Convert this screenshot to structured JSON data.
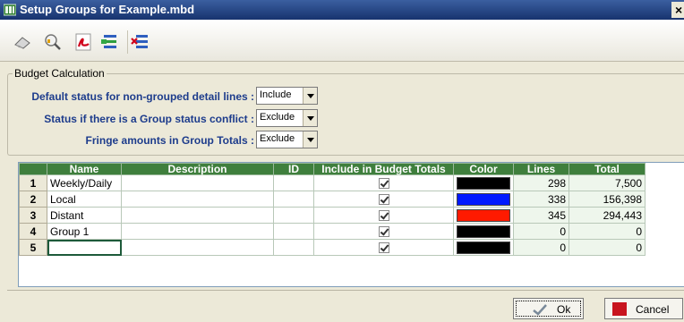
{
  "window": {
    "title": "Setup Groups for Example.mbd",
    "close_glyph": "×"
  },
  "toolbar": {
    "icons": [
      "eraser-icon",
      "search-icon",
      "pdf-icon",
      "add-group-icon",
      "delete-group-icon"
    ]
  },
  "budget_calc": {
    "legend": "Budget Calculation",
    "options": [
      {
        "label": "Default status for non-grouped detail lines :",
        "value": "Include"
      },
      {
        "label": "Status if there is a Group status conflict :",
        "value": "Exclude"
      },
      {
        "label": "Fringe amounts in Group Totals :",
        "value": "Exclude"
      }
    ]
  },
  "grid": {
    "columns": [
      "Name",
      "Description",
      "ID",
      "Include in Budget Totals",
      "Color",
      "Lines",
      "Total"
    ],
    "rows": [
      {
        "num": "1",
        "name": "Weekly/Daily",
        "description": "",
        "id": "",
        "include": true,
        "color": "#000000",
        "lines": "298",
        "total": "7,500"
      },
      {
        "num": "2",
        "name": "Local",
        "description": "",
        "id": "",
        "include": true,
        "color": "#0019ff",
        "lines": "338",
        "total": "156,398"
      },
      {
        "num": "3",
        "name": "Distant",
        "description": "",
        "id": "",
        "include": true,
        "color": "#ff1a00",
        "lines": "345",
        "total": "294,443"
      },
      {
        "num": "4",
        "name": "Group 1",
        "description": "",
        "id": "",
        "include": true,
        "color": "#000000",
        "lines": "0",
        "total": "0"
      },
      {
        "num": "5",
        "name": "",
        "description": "",
        "id": "",
        "include": true,
        "color": "#000000",
        "lines": "0",
        "total": "0"
      }
    ]
  },
  "buttons": {
    "ok_label": "Ok",
    "cancel_label": "Cancel"
  },
  "colors": {
    "header_green": "#3f7f3d",
    "cancel_red": "#c8141e",
    "label_blue": "#1d3c8c"
  }
}
